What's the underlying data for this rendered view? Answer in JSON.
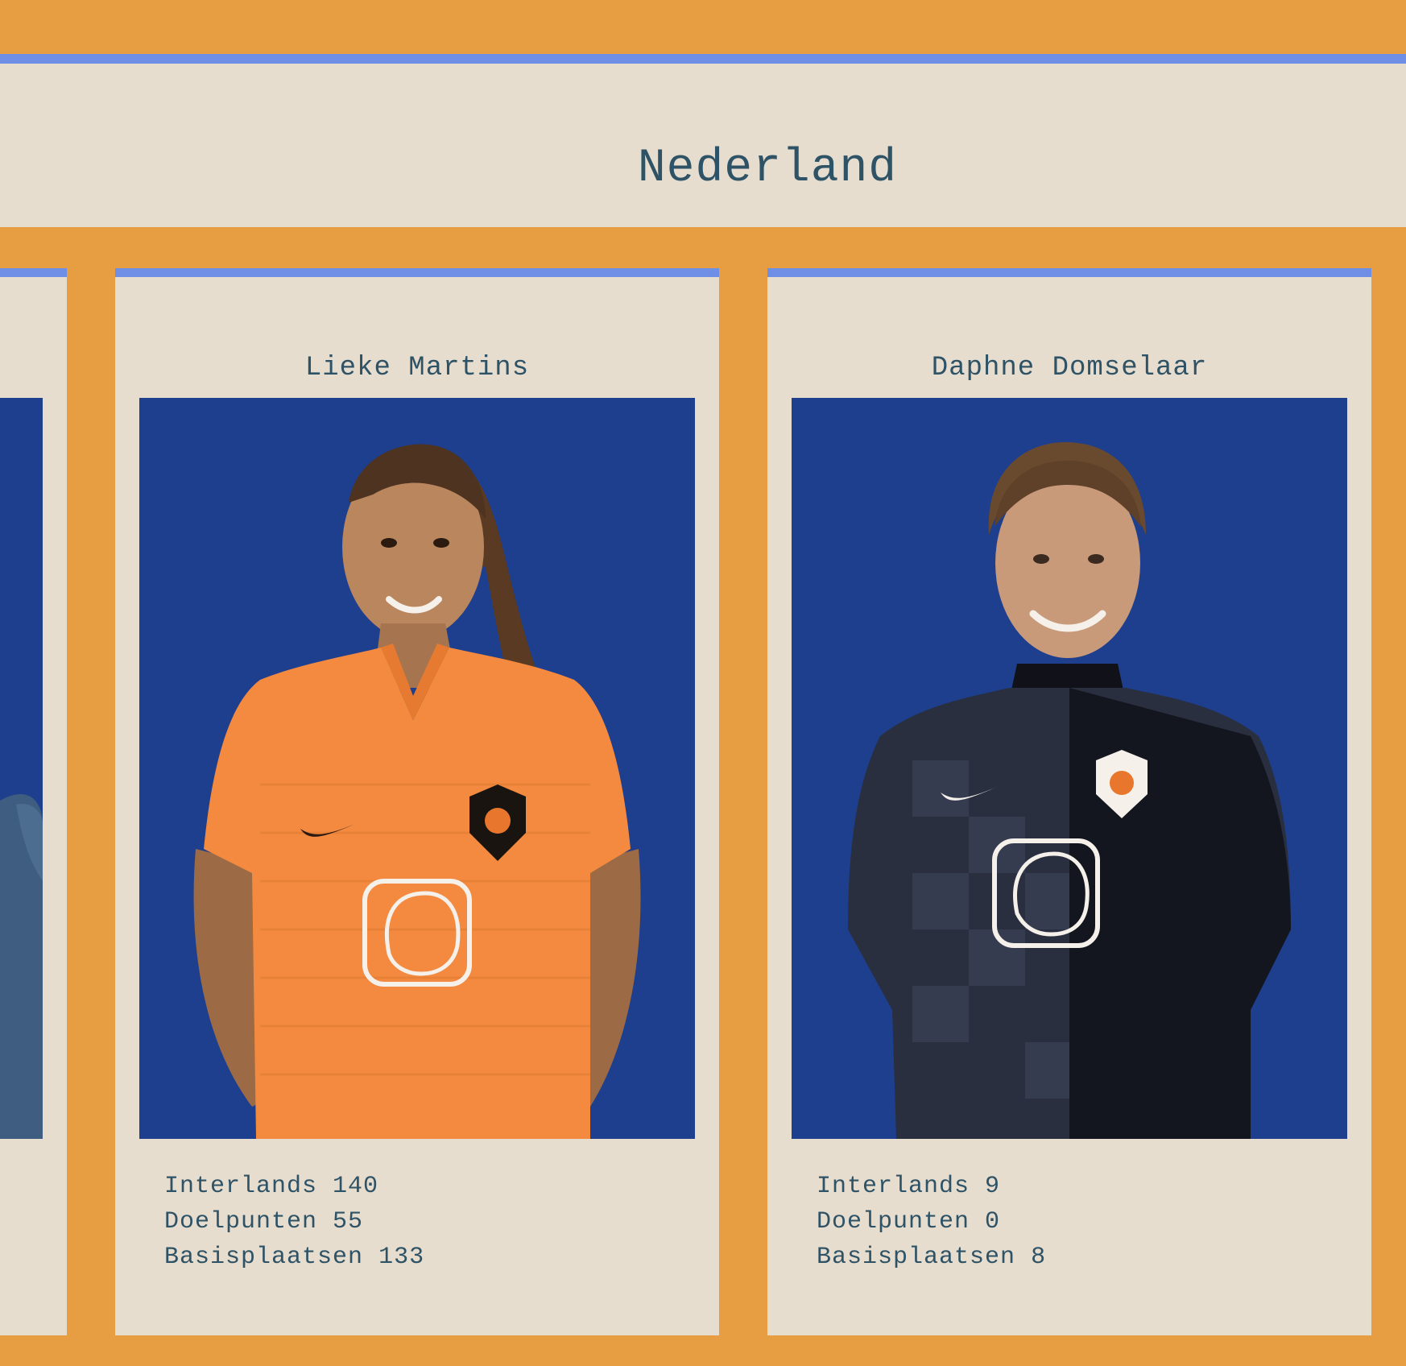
{
  "page": {
    "title": "Nederland",
    "accent_color": "#6f8ee6",
    "background_color": "#e79d41",
    "card_color": "#e7ddcf",
    "text_color": "#2e5366",
    "photo_background": "#1d3f8d"
  },
  "players": [
    {
      "name": "Lieke Martins",
      "shirt": "orange-home-shirt",
      "stats": [
        {
          "label": "Interlands",
          "value": "140"
        },
        {
          "label": "Doelpunten",
          "value": "55"
        },
        {
          "label": "Basisplaatsen",
          "value": "133"
        }
      ]
    },
    {
      "name": "Daphne Domselaar",
      "shirt": "dark-goalkeeper-shirt",
      "stats": [
        {
          "label": "Interlands",
          "value": "9"
        },
        {
          "label": "Doelpunten",
          "value": "0"
        },
        {
          "label": "Basisplaatsen",
          "value": "8"
        }
      ]
    }
  ]
}
